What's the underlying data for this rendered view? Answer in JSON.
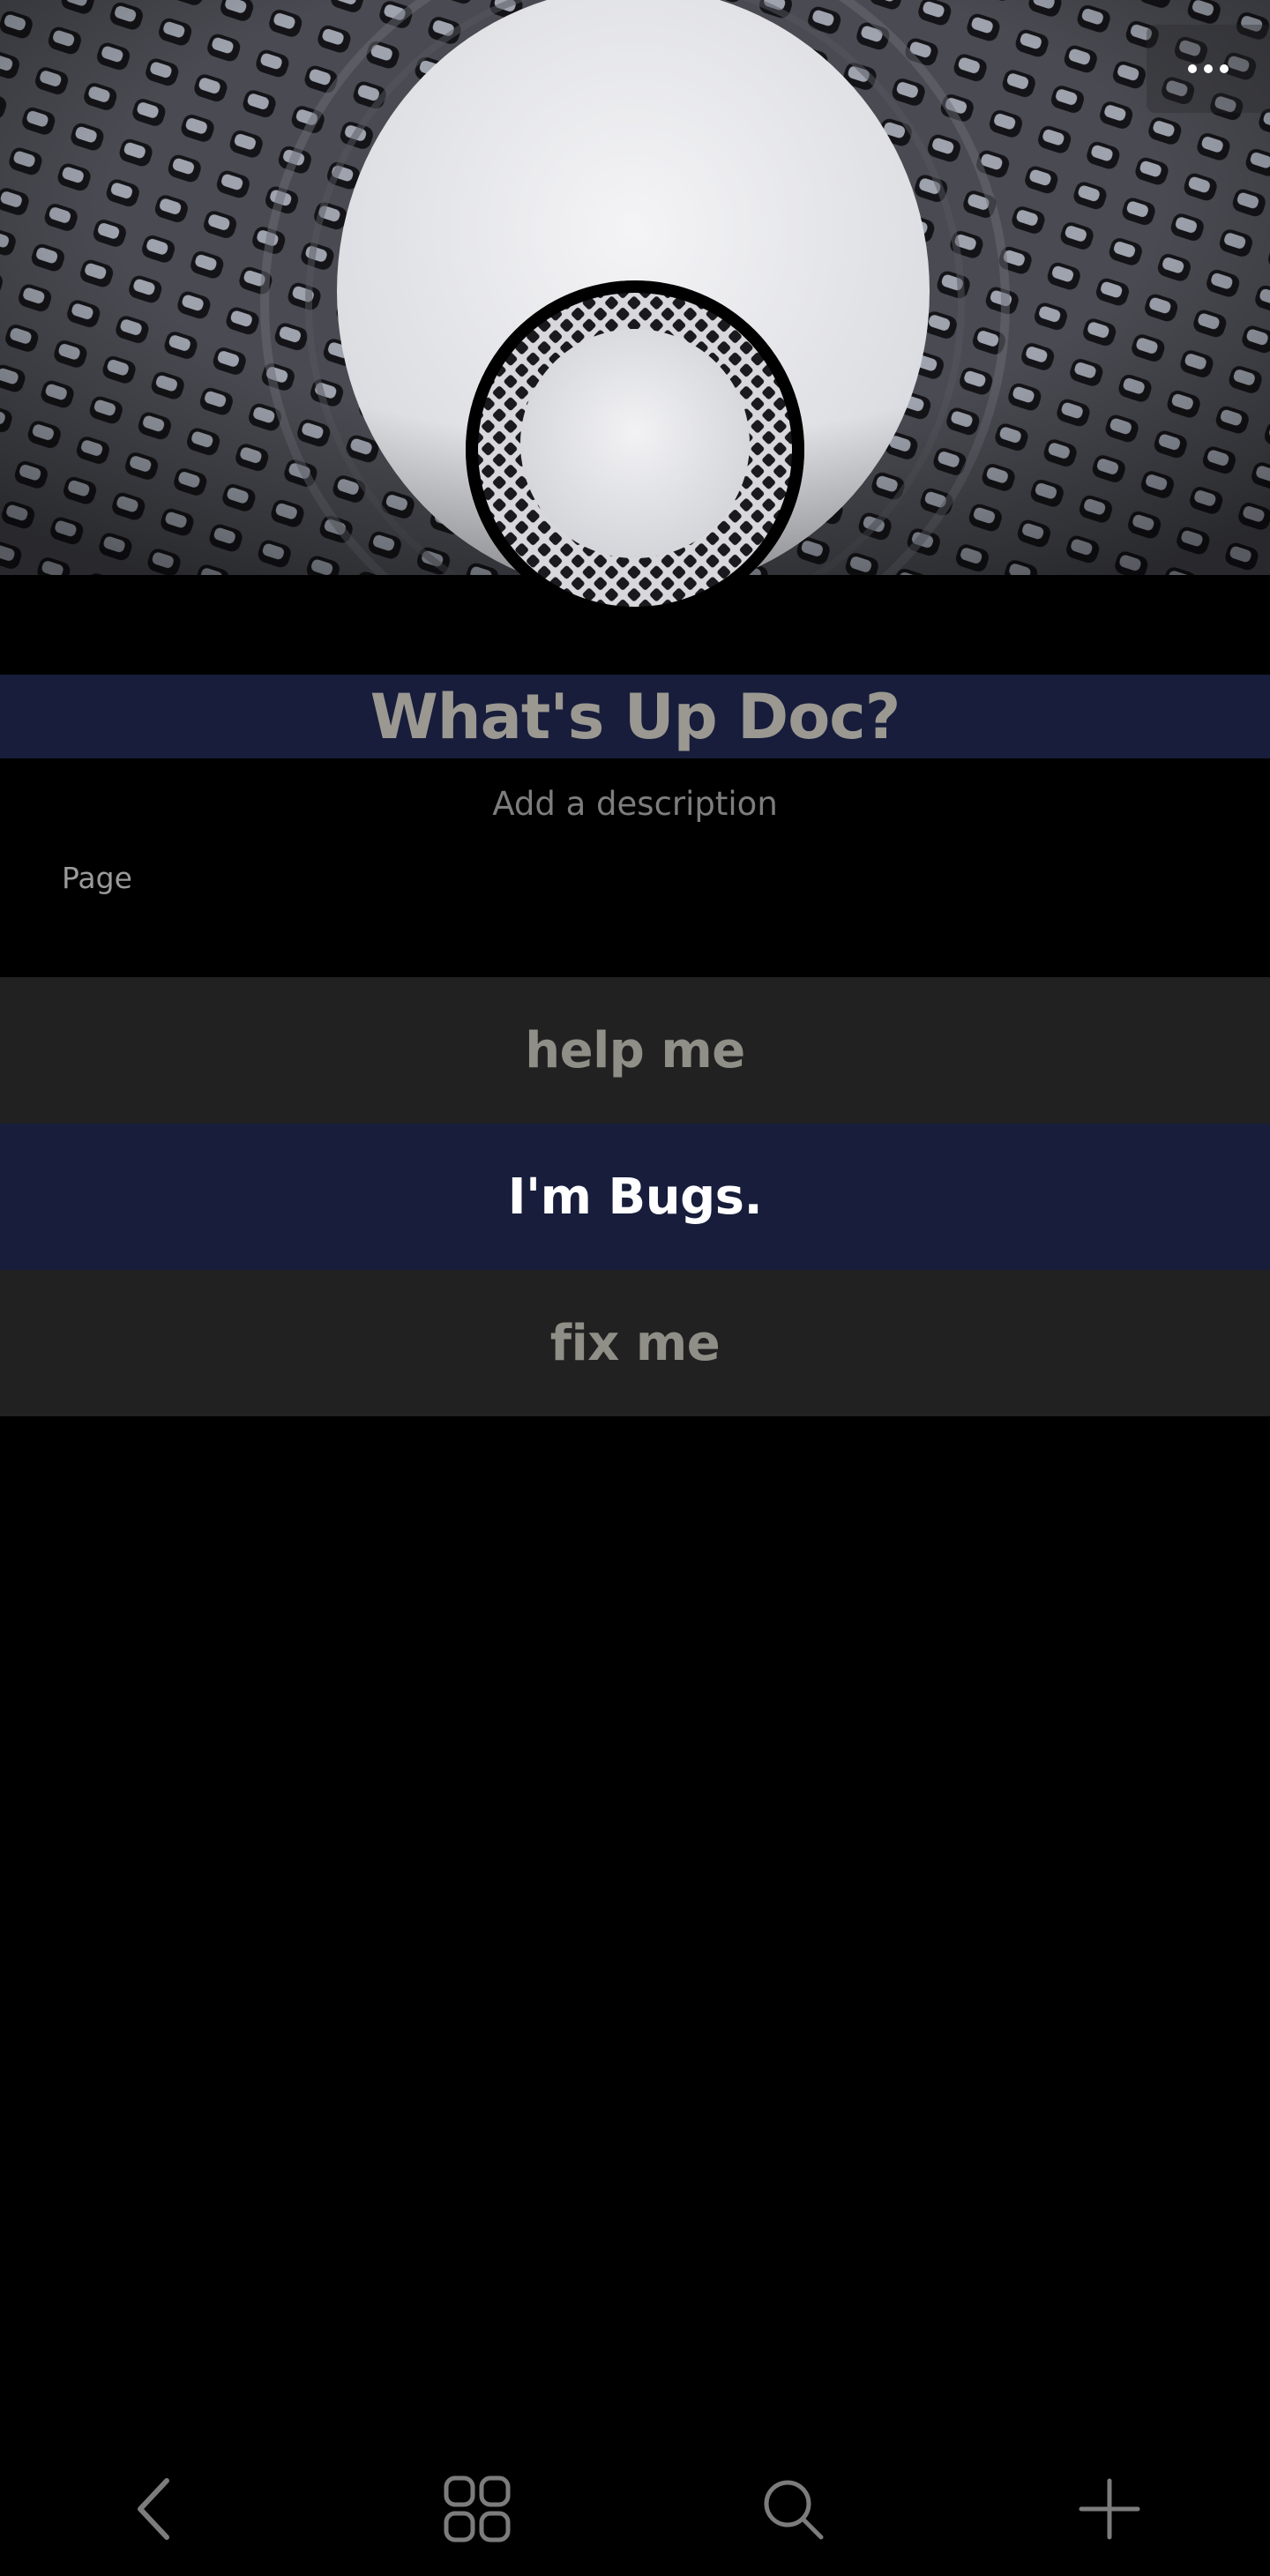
{
  "header": {
    "more_icon": "more-horizontal-icon",
    "cover_image": "cover-photo",
    "avatar_image": "profile-avatar"
  },
  "profile": {
    "title": "What's Up Doc?",
    "description_placeholder": "Add a description",
    "section_label": "Page"
  },
  "links": [
    {
      "label": "help me",
      "highlighted": false
    },
    {
      "label": "I'm Bugs.",
      "highlighted": true
    },
    {
      "label": "fix me",
      "highlighted": false
    }
  ],
  "bottom_nav": [
    {
      "icon": "back-icon"
    },
    {
      "icon": "grid-icon"
    },
    {
      "icon": "search-icon"
    },
    {
      "icon": "plus-icon"
    }
  ],
  "colors": {
    "background": "#000000",
    "title_bar": "#171d3b",
    "link_bg": "#212121",
    "link_highlight_bg": "#171d3b",
    "muted_text": "#8f8f88"
  }
}
